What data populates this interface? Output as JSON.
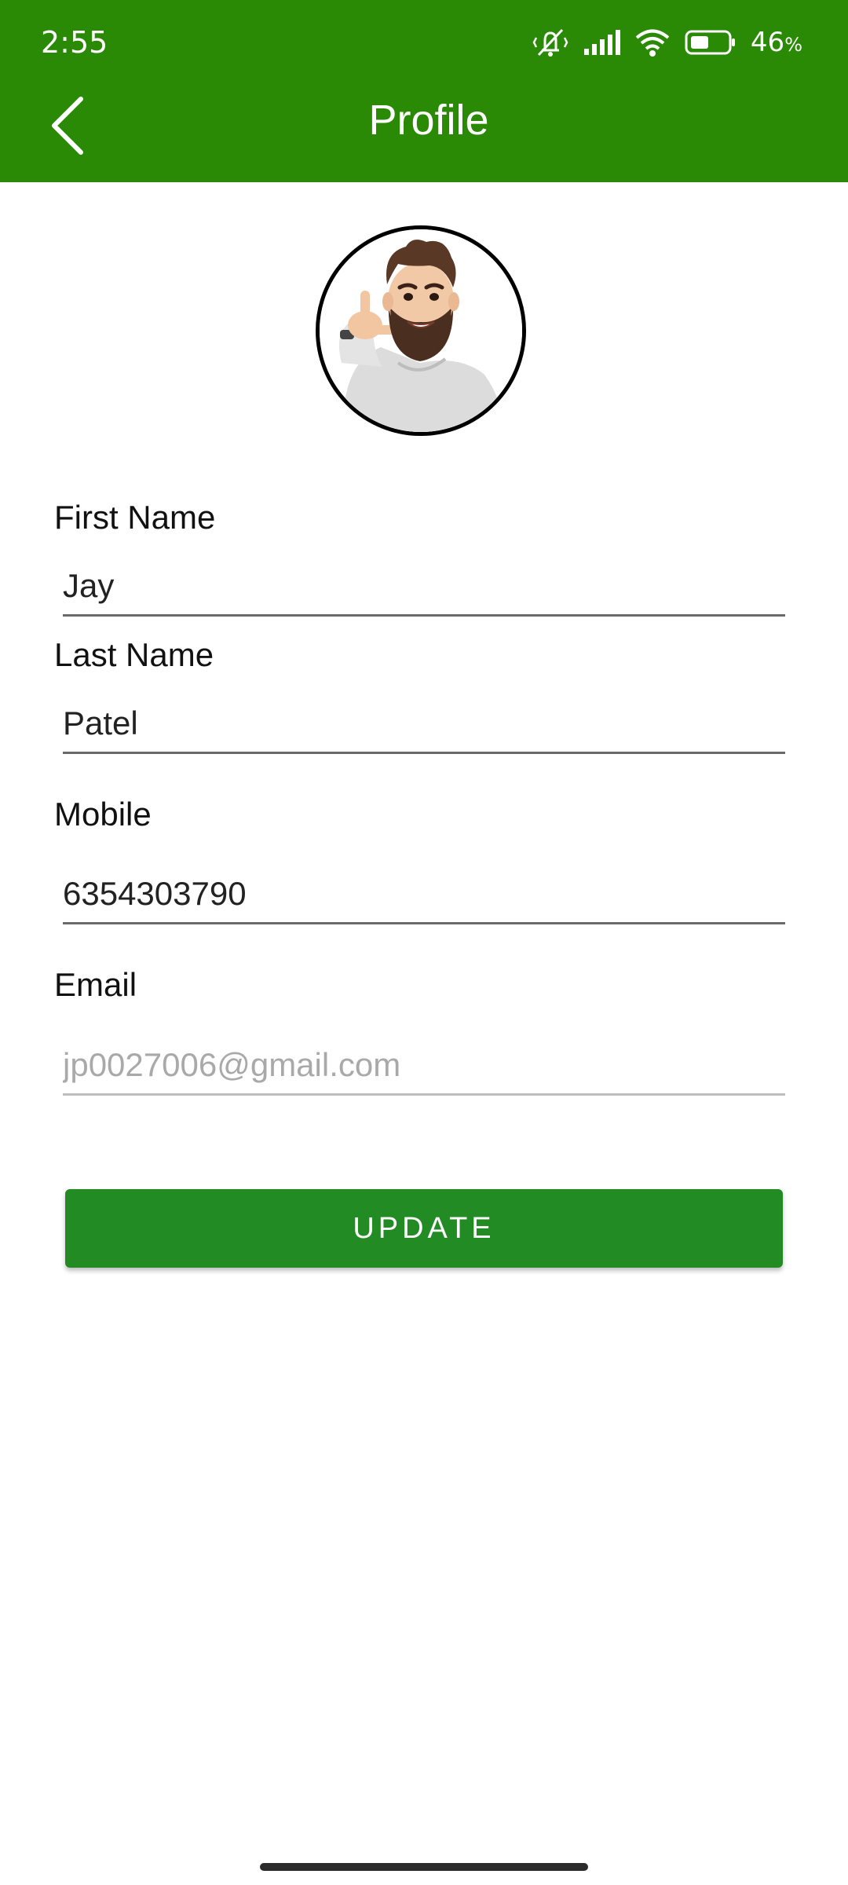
{
  "status_bar": {
    "time": "2:55",
    "battery_percent": "46",
    "battery_suffix": "%",
    "icons": [
      "mute-vibrate-icon",
      "signal-icon",
      "wifi-icon",
      "battery-icon"
    ]
  },
  "header": {
    "title": "Profile",
    "back_icon": "chevron-left-icon",
    "background_color": "#2a8a06"
  },
  "avatar": {
    "icon": "memoji-avatar"
  },
  "form": {
    "first_name": {
      "label": "First Name",
      "value": "Jay"
    },
    "last_name": {
      "label": "Last Name",
      "value": "Patel"
    },
    "mobile": {
      "label": "Mobile",
      "value": "6354303790"
    },
    "email": {
      "label": "Email",
      "value": "jp0027006@gmail.com",
      "disabled": true
    }
  },
  "update_button": {
    "label": "UPDATE",
    "color": "#238b23"
  }
}
